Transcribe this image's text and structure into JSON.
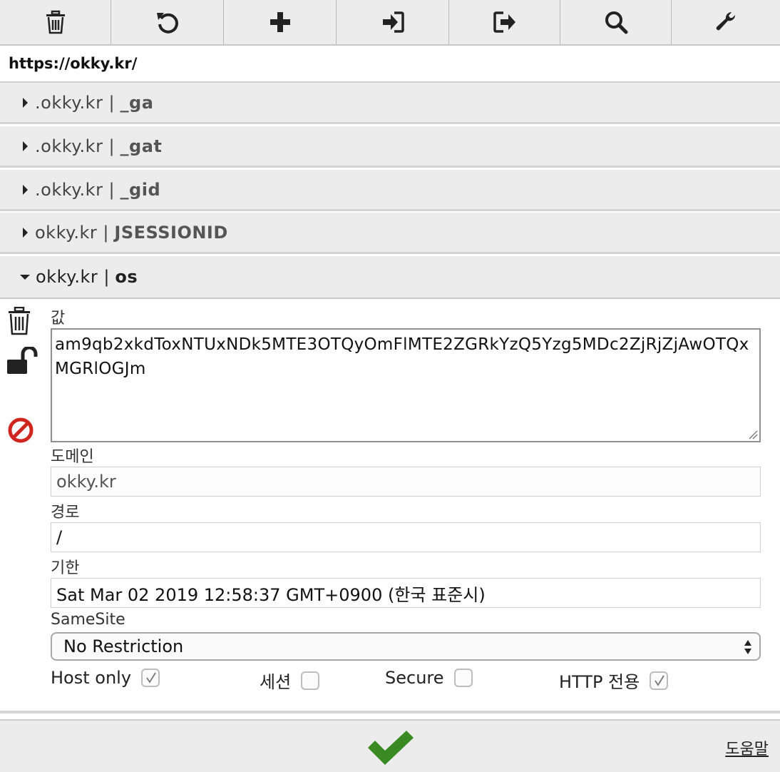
{
  "toolbar": {
    "buttons": [
      {
        "icon": "trash-icon"
      },
      {
        "icon": "undo-icon"
      },
      {
        "icon": "plus-icon"
      },
      {
        "icon": "import-icon"
      },
      {
        "icon": "export-icon"
      },
      {
        "icon": "search-icon"
      },
      {
        "icon": "wrench-icon"
      }
    ]
  },
  "url": "https://okky.kr/",
  "cookies": [
    {
      "domain": ".okky.kr",
      "separator": "|",
      "name": "_ga"
    },
    {
      "domain": ".okky.kr",
      "separator": "|",
      "name": "_gat"
    },
    {
      "domain": ".okky.kr",
      "separator": "|",
      "name": "_gid"
    },
    {
      "domain": "okky.kr",
      "separator": "|",
      "name": "JSESSIONID"
    },
    {
      "domain": "okky.kr",
      "separator": "|",
      "name": "os"
    }
  ],
  "editor": {
    "value_label": "값",
    "value": "am9qb2xkdToxNTUxNDk5MTE3OTQyOmFlMTE2ZGRkYzQ5Yzg5MDc2ZjRjZjAwOTQxMGRlOGJm",
    "domain_label": "도메인",
    "domain": "okky.kr",
    "path_label": "경로",
    "path": "/",
    "expires_label": "기한",
    "expires": "Sat Mar 02 2019 12:58:37 GMT+0900 (한국 표준시)",
    "samesite_label": "SameSite",
    "samesite": "No Restriction",
    "flags": {
      "host_only": {
        "label": "Host only",
        "checked": true
      },
      "session": {
        "label": "세션",
        "checked": false
      },
      "secure": {
        "label": "Secure",
        "checked": false
      },
      "http_only": {
        "label": "HTTP 전용",
        "checked": true
      }
    }
  },
  "footer": {
    "save_icon": "checkmark-icon",
    "help": "도움말"
  },
  "colors": {
    "save_green": "#3a8a24",
    "block_red": "#d0251f"
  }
}
